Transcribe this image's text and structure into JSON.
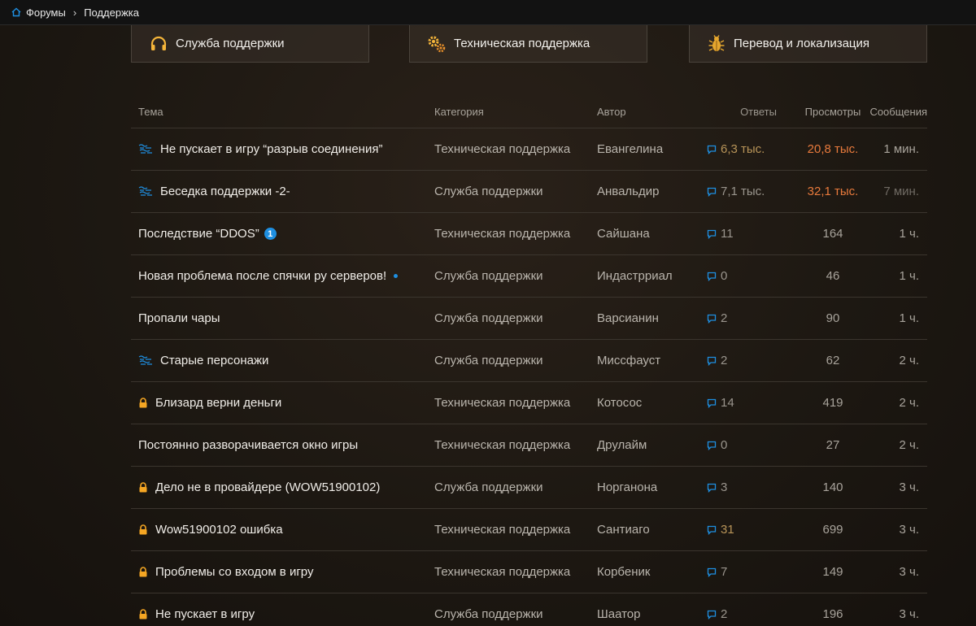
{
  "breadcrumb": {
    "home_label": "Форумы",
    "current_label": "Поддержка"
  },
  "categories": [
    {
      "label": "Служба поддержки",
      "icon": "headphones-icon"
    },
    {
      "label": "Техническая поддержка",
      "icon": "gears-icon"
    },
    {
      "label": "Перевод и локализация",
      "icon": "bug-icon"
    }
  ],
  "table": {
    "headers": {
      "topic": "Тема",
      "category": "Категория",
      "author": "Автор",
      "replies": "Ответы",
      "views": "Просмотры",
      "messages": "Сообщения"
    },
    "rows": [
      {
        "topic": "Не пускает в игру “разрыв соединения”",
        "prefix": "blizzard",
        "badge": "",
        "dot": false,
        "category": "Техническая поддержка",
        "author": "Евангелина",
        "replies": "6,3 тыс.",
        "views": "20,8 тыс.",
        "last": "1 мин.",
        "replies_style": "amber",
        "views_style": "orange",
        "last_style": ""
      },
      {
        "topic": "Беседка поддержки -2-",
        "prefix": "blizzard",
        "badge": "",
        "dot": false,
        "category": "Служба поддержки",
        "author": "Анвальдир",
        "replies": "7,1 тыс.",
        "views": "32,1 тыс.",
        "last": "7 мин.",
        "replies_style": "",
        "views_style": "orange",
        "last_style": "dim"
      },
      {
        "topic": "Последствие “DDOS”",
        "prefix": "",
        "badge": "1",
        "dot": false,
        "category": "Техническая поддержка",
        "author": "Сайшана",
        "replies": "11",
        "views": "164",
        "last": "1 ч.",
        "replies_style": "",
        "views_style": "",
        "last_style": ""
      },
      {
        "topic": "Новая проблема после спячки ру серверов!",
        "prefix": "",
        "badge": "",
        "dot": true,
        "category": "Служба поддержки",
        "author": "Индастрриал",
        "replies": "0",
        "views": "46",
        "last": "1 ч.",
        "replies_style": "",
        "views_style": "",
        "last_style": ""
      },
      {
        "topic": "Пропали чары",
        "prefix": "",
        "badge": "",
        "dot": false,
        "category": "Служба поддержки",
        "author": "Варсианин",
        "replies": "2",
        "views": "90",
        "last": "1 ч.",
        "replies_style": "",
        "views_style": "",
        "last_style": ""
      },
      {
        "topic": "Старые персонажи",
        "prefix": "blizzard",
        "badge": "",
        "dot": false,
        "category": "Служба поддержки",
        "author": "Миссфауст",
        "replies": "2",
        "views": "62",
        "last": "2 ч.",
        "replies_style": "",
        "views_style": "",
        "last_style": ""
      },
      {
        "topic": "Близард верни деньги",
        "prefix": "lock",
        "badge": "",
        "dot": false,
        "category": "Техническая поддержка",
        "author": "Котосос",
        "replies": "14",
        "views": "419",
        "last": "2 ч.",
        "replies_style": "",
        "views_style": "",
        "last_style": ""
      },
      {
        "topic": "Постоянно разворачивается окно игры",
        "prefix": "",
        "badge": "",
        "dot": false,
        "category": "Техническая поддержка",
        "author": "Друлайм",
        "replies": "0",
        "views": "27",
        "last": "2 ч.",
        "replies_style": "",
        "views_style": "",
        "last_style": ""
      },
      {
        "topic": "Дело не в провайдере (WOW51900102)",
        "prefix": "lock",
        "badge": "",
        "dot": false,
        "category": "Служба поддержки",
        "author": "Норганона",
        "replies": "3",
        "views": "140",
        "last": "3 ч.",
        "replies_style": "",
        "views_style": "",
        "last_style": ""
      },
      {
        "topic": "Wow51900102 ошибка",
        "prefix": "lock",
        "badge": "",
        "dot": false,
        "category": "Техническая поддержка",
        "author": "Сантиаго",
        "replies": "31",
        "views": "699",
        "last": "3 ч.",
        "replies_style": "amber",
        "views_style": "",
        "last_style": ""
      },
      {
        "topic": "Проблемы со входом в игру",
        "prefix": "lock",
        "badge": "",
        "dot": false,
        "category": "Техническая поддержка",
        "author": "Корбеник",
        "replies": "7",
        "views": "149",
        "last": "3 ч.",
        "replies_style": "",
        "views_style": "",
        "last_style": ""
      },
      {
        "topic": "Не пускает в игру",
        "prefix": "lock",
        "badge": "",
        "dot": false,
        "category": "Служба поддержки",
        "author": "Шаатор",
        "replies": "2",
        "views": "196",
        "last": "3 ч.",
        "replies_style": "",
        "views_style": "",
        "last_style": ""
      }
    ]
  },
  "colors": {
    "accent_blue": "#1e8fe1",
    "lock_orange": "#f5a623",
    "hot_orange": "#e87a3c"
  }
}
